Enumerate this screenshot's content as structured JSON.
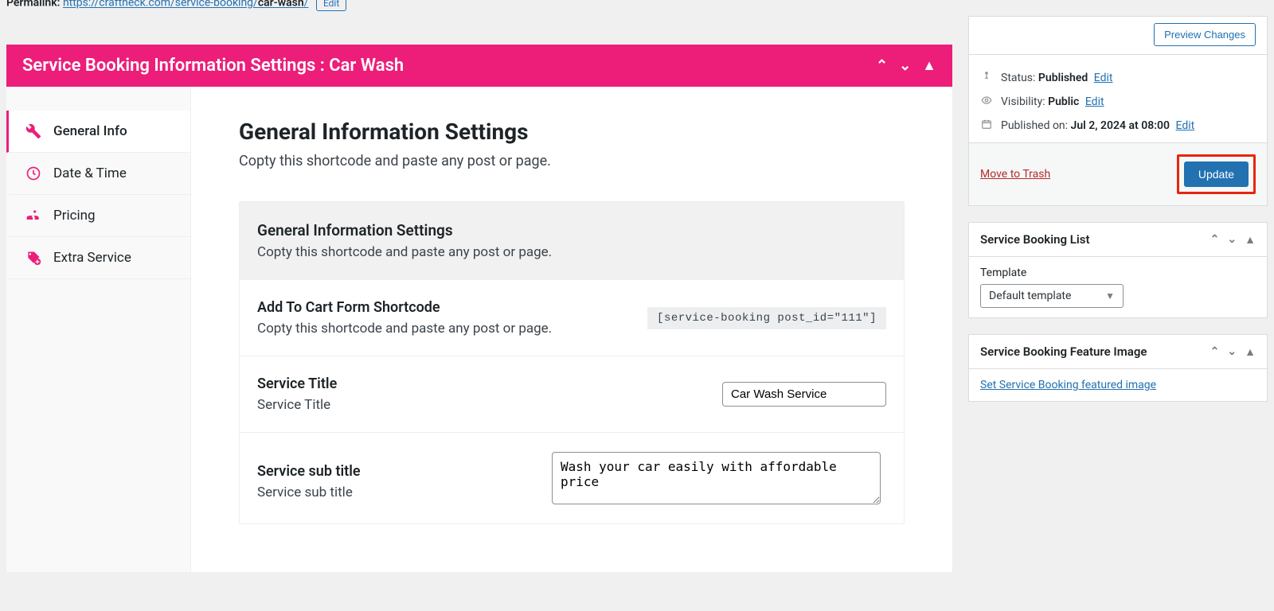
{
  "permalink": {
    "label": "Permalink:",
    "url_text": "https://craftheck.com/service-booking/car-wash/",
    "bold_segment": "car-wash",
    "edit": "Edit"
  },
  "pink_title": "Service Booking Information Settings : Car Wash",
  "tabs": [
    {
      "label": "General Info"
    },
    {
      "label": "Date & Time"
    },
    {
      "label": "Pricing"
    },
    {
      "label": "Extra Service"
    }
  ],
  "content": {
    "heading": "General Information Settings",
    "lead": "Copty this shortcode and paste any post or page.",
    "table_head_title": "General Information Settings",
    "table_head_sub": "Copty this shortcode and paste any post or page.",
    "shortcode_label": "Add To Cart Form Shortcode",
    "shortcode_sub": "Copty this shortcode and paste any post or page.",
    "shortcode_value": "[service-booking post_id=\"111\"]",
    "title_label": "Service Title",
    "title_sub": "Service Title",
    "title_value": "Car Wash Service",
    "subtitle_label": "Service sub title",
    "subtitle_sub": "Service sub title",
    "subtitle_value": "Wash your car easily with affordable price"
  },
  "publish": {
    "preview": "Preview Changes",
    "status_label": "Status:",
    "status_value": "Published",
    "visibility_label": "Visibility:",
    "visibility_value": "Public",
    "published_label": "Published on:",
    "published_value": "Jul 2, 2024 at 08:00",
    "edit": "Edit",
    "trash": "Move to Trash",
    "update": "Update"
  },
  "booking_list": {
    "title": "Service Booking List",
    "template_label": "Template",
    "template_value": "Default template"
  },
  "feature_image": {
    "title": "Service Booking Feature Image",
    "link": "Set Service Booking featured image"
  }
}
